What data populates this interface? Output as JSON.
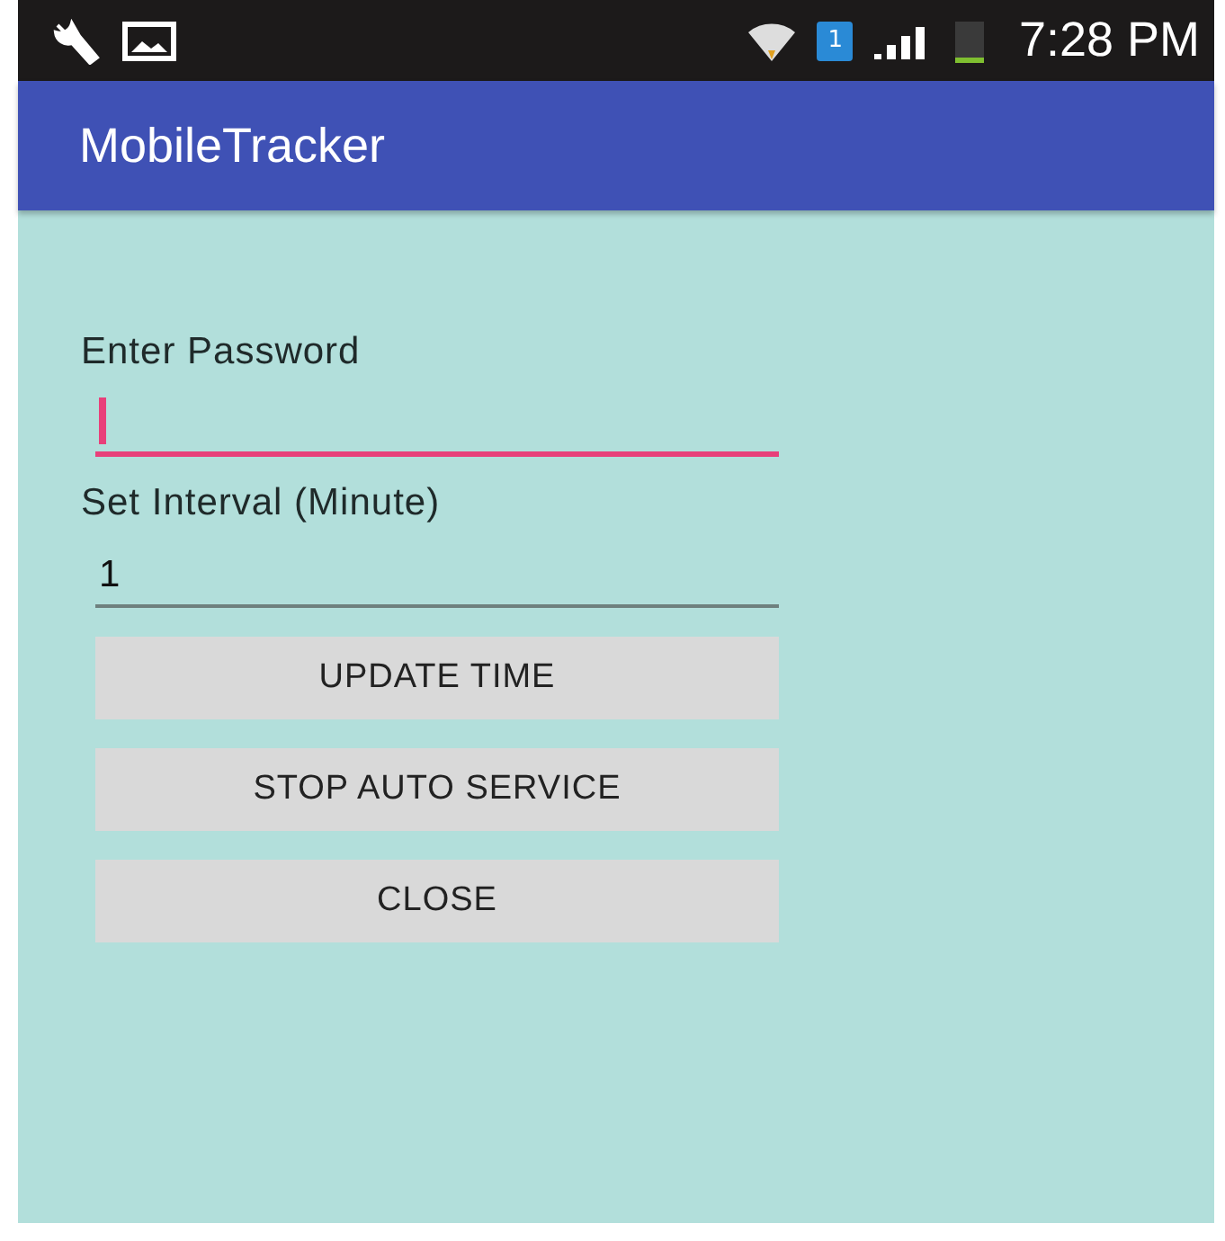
{
  "status_bar": {
    "sim_badge": "1",
    "time": "7:28 PM"
  },
  "app_bar": {
    "title": "MobileTracker"
  },
  "fields": [
    {
      "label": "Enter Password",
      "focused": true
    },
    {
      "label": "Set Interval (Minute)",
      "value": "1",
      "focused": false
    }
  ],
  "buttons": [
    "UPDATE TIME",
    "STOP AUTO SERVICE",
    "CLOSE"
  ]
}
